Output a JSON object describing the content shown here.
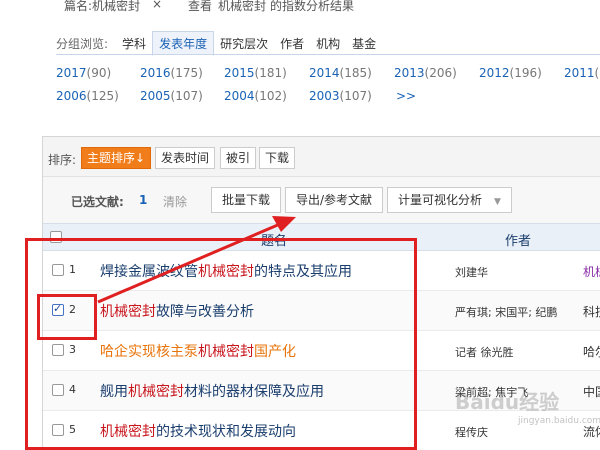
{
  "top": {
    "filter_text": "篇名:机械密封",
    "close_icon": "×",
    "result_prefix": "查看",
    "result_keyword": "机械密封",
    "result_suffix": "的指数分析结果"
  },
  "group": {
    "label": "分组浏览:",
    "tabs": [
      "学科",
      "发表年度",
      "研究层次",
      "作者",
      "机构",
      "基金"
    ],
    "active": "发表年度"
  },
  "years": [
    {
      "year": "2017",
      "count": "(90)"
    },
    {
      "year": "2016",
      "count": "(175)"
    },
    {
      "year": "2015",
      "count": "(181)"
    },
    {
      "year": "2014",
      "count": "(185)"
    },
    {
      "year": "2013",
      "count": "(206)"
    },
    {
      "year": "2012",
      "count": "(196)"
    },
    {
      "year": "2011",
      "count": "("
    },
    {
      "year": "2006",
      "count": "(125)"
    },
    {
      "year": "2005",
      "count": "(107)"
    },
    {
      "year": "2004",
      "count": "(102)"
    },
    {
      "year": "2003",
      "count": "(107)"
    }
  ],
  "more_label": ">>",
  "sort": {
    "label": "排序:",
    "buttons": [
      "主题排序↓",
      "发表时间",
      "被引",
      "下载"
    ]
  },
  "selection": {
    "label": "已选文献:",
    "count": "1",
    "clear": "清除",
    "batch_download": "批量下载",
    "export": "导出/参考文献",
    "visual": "计量可视化分析"
  },
  "table": {
    "col_title": "题名",
    "col_author": "作者",
    "rows": [
      {
        "num": "1",
        "pre": "焊接金属波纹管",
        "hl": "机械密封",
        "post": "的特点及其应用",
        "author": "刘建华",
        "source": "机械",
        "checked": false,
        "style": "normal"
      },
      {
        "num": "2",
        "pre": "",
        "hl": "机械密封",
        "post": "故障与改善分析",
        "author": "严有琪; 宋国平; 纪鹏",
        "source": "科技",
        "checked": true,
        "style": "normal"
      },
      {
        "num": "3",
        "pre": "哈企实现核主泵",
        "hl": "机械密封",
        "post": "国产化",
        "author": "记者  徐光胜",
        "source": "哈尔",
        "checked": false,
        "style": "orange"
      },
      {
        "num": "4",
        "pre": "舰用",
        "hl": "机械密封",
        "post": "材料的器材保障及应用",
        "author": "梁前超; 焦宇飞",
        "source": "中国",
        "checked": false,
        "style": "normal"
      },
      {
        "num": "5",
        "pre": "",
        "hl": "机械密封",
        "post": "的技术现状和发展动向",
        "author": "程传庆",
        "source": "流体",
        "checked": false,
        "style": "normal"
      }
    ]
  },
  "watermark": "Baidu经验",
  "watermark_sub": "jingyan.baidu.com",
  "colors": {
    "accent": "#1a62b5",
    "highlight": "#c8161d",
    "sort_active": "#f07c1a",
    "annotation": "#e02020"
  }
}
